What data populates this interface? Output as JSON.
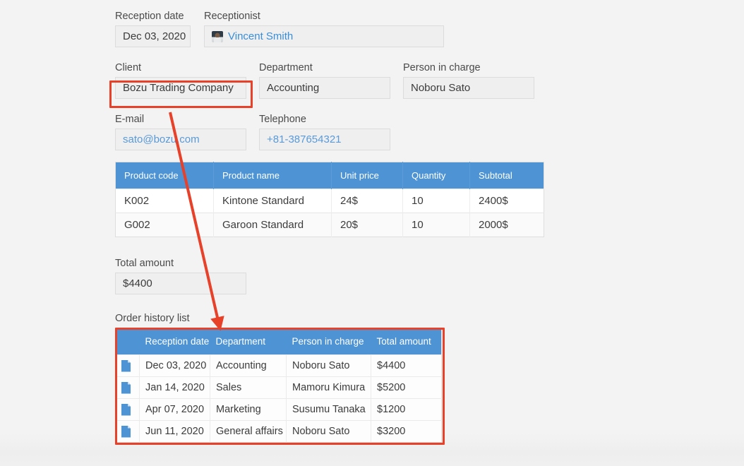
{
  "form": {
    "reception": {
      "date_label": "Reception date",
      "date_value": "Dec 03, 2020",
      "receptionist_label": "Receptionist",
      "receptionist_value": "Vincent Smith",
      "receptionist_avatar_icon": "user-photo-avatar"
    },
    "client_row": {
      "client_label": "Client",
      "client_value": "Bozu Trading Company",
      "department_label": "Department",
      "department_value": "Accounting",
      "person_label": "Person in charge",
      "person_value": "Noboru Sato"
    },
    "contact_row": {
      "email_label": "E-mail",
      "email_value": "sato@bozu.com",
      "telephone_label": "Telephone",
      "telephone_value": "+81-387654321"
    },
    "total": {
      "label": "Total amount",
      "value": "$4400"
    }
  },
  "product_table": {
    "columns": [
      "Product code",
      "Product name",
      "Unit price",
      "Quantity",
      "Subtotal"
    ],
    "rows": [
      {
        "code": "K002",
        "name": "Kintone Standard",
        "price": "24$",
        "qty": "10",
        "subtotal": "2400$"
      },
      {
        "code": "G002",
        "name": "Garoon Standard",
        "price": "20$",
        "qty": "10",
        "subtotal": "2000$"
      }
    ]
  },
  "order_history": {
    "label": "Order history list",
    "columns": [
      "",
      "Reception date",
      "Department",
      "Person in charge",
      "Total amount"
    ],
    "row_icon": "document-file-icon",
    "rows": [
      {
        "date": "Dec 03, 2020",
        "department": "Accounting",
        "person": "Noboru Sato",
        "total": "$4400"
      },
      {
        "date": "Jan 14, 2020",
        "department": "Sales",
        "person": "Mamoru Kimura",
        "total": "$5200"
      },
      {
        "date": "Apr 07, 2020",
        "department": "Marketing",
        "person": "Susumu Tanaka",
        "total": "$1200"
      },
      {
        "date": "Jun 11, 2020",
        "department": "General affairs",
        "person": "Noboru Sato",
        "total": "$3200"
      }
    ]
  },
  "annotations": {
    "highlight_color": "#e8412a",
    "arrow_color": "#e8412a",
    "client_highlight_name": "client-field-highlight",
    "history_highlight_name": "order-history-highlight",
    "arrow_name": "client-to-history-arrow"
  },
  "theme": {
    "background": "#f3f3f3",
    "table_header_blue": "#4e94d4",
    "link_blue": "#5a9ad8",
    "field_background": "#efefef"
  }
}
